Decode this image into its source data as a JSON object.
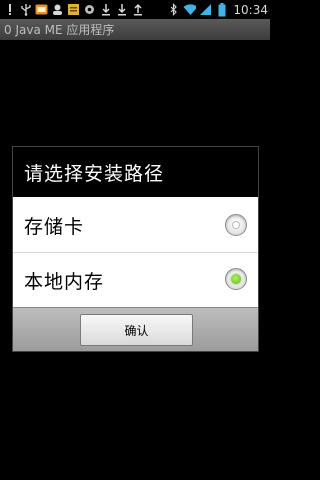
{
  "status_bar": {
    "notification_icons": [
      "exclamation-icon",
      "usb-icon",
      "mail-icon",
      "user-icon",
      "file-icon",
      "settings-icon",
      "download-icon",
      "download-icon",
      "upload-icon"
    ],
    "clock": "10:34"
  },
  "app": {
    "title": "0 Java ME 应用程序"
  },
  "dialog": {
    "title": "请选择安装路径",
    "options": [
      {
        "label": "存储卡",
        "selected": false
      },
      {
        "label": "本地内存",
        "selected": true
      }
    ],
    "confirm_label": "确认"
  },
  "colors": {
    "radio_selected": "#6fcf25",
    "dialog_header": "#000000",
    "button_bar": "#a9a9a9"
  }
}
